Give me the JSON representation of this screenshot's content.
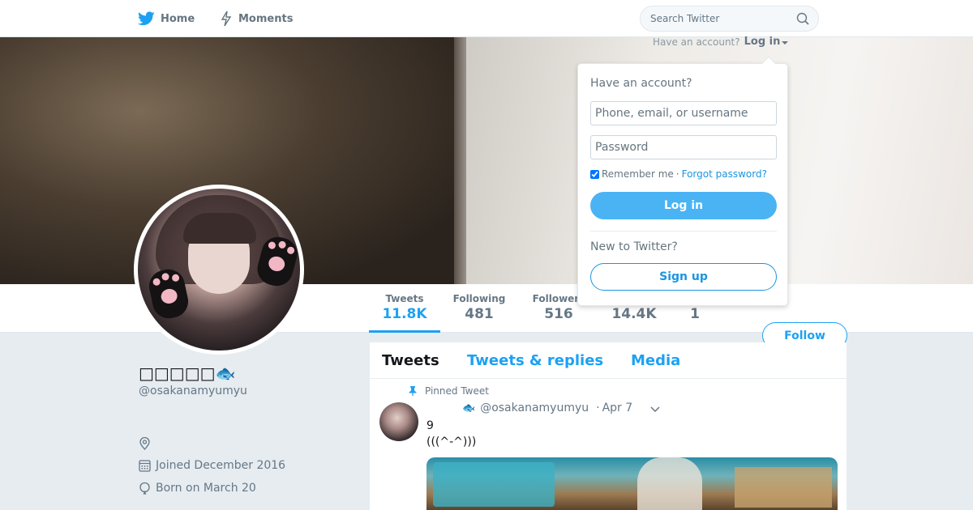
{
  "nav": {
    "home_label": "Home",
    "moments_label": "Moments",
    "search_placeholder": "Search Twitter"
  },
  "login_prompt": {
    "text": "Have an account?",
    "link": "Log in"
  },
  "login_dropdown": {
    "title": "Have an account?",
    "username_placeholder": "Phone, email, or username",
    "password_placeholder": "Password",
    "remember_label": "Remember me",
    "separator": "·",
    "forgot_label": "Forgot password?",
    "login_button": "Log in",
    "new_label": "New to Twitter?",
    "signup_button": "Sign up",
    "remember_checked": true
  },
  "profile": {
    "name": "□□□□□",
    "name_emoji": "🐟",
    "handle": "@osakanamyumyu",
    "joined": "Joined December 2016",
    "born": "Born on March 20"
  },
  "stats": [
    {
      "label": "Tweets",
      "value": "11.8K"
    },
    {
      "label": "Following",
      "value": "481"
    },
    {
      "label": "Followers",
      "value": "516"
    },
    {
      "label": "",
      "value": "14.4K"
    },
    {
      "label": "",
      "value": "1"
    }
  ],
  "follow_button": "Follow",
  "tabs": [
    "Tweets",
    "Tweets & replies",
    "Media"
  ],
  "tweet": {
    "pinned_label": "Pinned Tweet",
    "name_emoji": "🐟",
    "handle": "@osakanamyumyu",
    "dot": "·",
    "date": "Apr 7",
    "text": "9\n(((^-^)))"
  },
  "colors": {
    "accent": "#1da1f2",
    "login_button": "#4ab3f4",
    "background": "#e6ecf0"
  }
}
